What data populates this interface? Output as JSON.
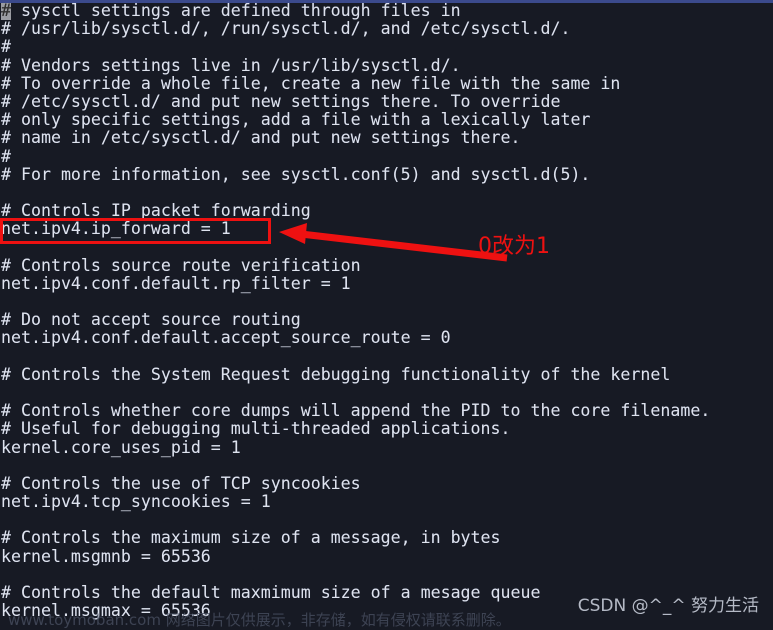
{
  "window": {
    "top_edge_color": "#3b4a8c",
    "background_color": "#171a24",
    "text_color": "#dfe3ee"
  },
  "terminal": {
    "cursor": "block-cursor",
    "lines": [
      "# sysctl settings are defined through files in",
      "# /usr/lib/sysctl.d/, /run/sysctl.d/, and /etc/sysctl.d/.",
      "#",
      "# Vendors settings live in /usr/lib/sysctl.d/.",
      "# To override a whole file, create a new file with the same in",
      "# /etc/sysctl.d/ and put new settings there. To override",
      "# only specific settings, add a file with a lexically later",
      "# name in /etc/sysctl.d/ and put new settings there.",
      "#",
      "# For more information, see sysctl.conf(5) and sysctl.d(5).",
      "",
      "# Controls IP packet forwarding",
      "net.ipv4.ip_forward = 1",
      "",
      "# Controls source route verification",
      "net.ipv4.conf.default.rp_filter = 1",
      "",
      "# Do not accept source routing",
      "net.ipv4.conf.default.accept_source_route = 0",
      "",
      "# Controls the System Request debugging functionality of the kernel",
      "",
      "# Controls whether core dumps will append the PID to the core filename.",
      "# Useful for debugging multi-threaded applications.",
      "kernel.core_uses_pid = 1",
      "",
      "# Controls the use of TCP syncookies",
      "net.ipv4.tcp_syncookies = 1",
      "",
      "# Controls the maximum size of a message, in bytes",
      "kernel.msgmnb = 65536",
      "",
      "# Controls the default maxmimum size of a mesage queue",
      "kernel.msgmax = 65536"
    ]
  },
  "annotation": {
    "color": "#ee1111",
    "text": "0改为1",
    "highlighted_line": "net.ipv4.ip_forward = 1",
    "arrow_icon": "left-arrow-icon"
  },
  "watermarks": {
    "csdn": "CSDN @^_^ 努力生活",
    "footer": "www.toymoban.com 网络图片仅供展示，非存储，如有侵权请联系删除。"
  }
}
